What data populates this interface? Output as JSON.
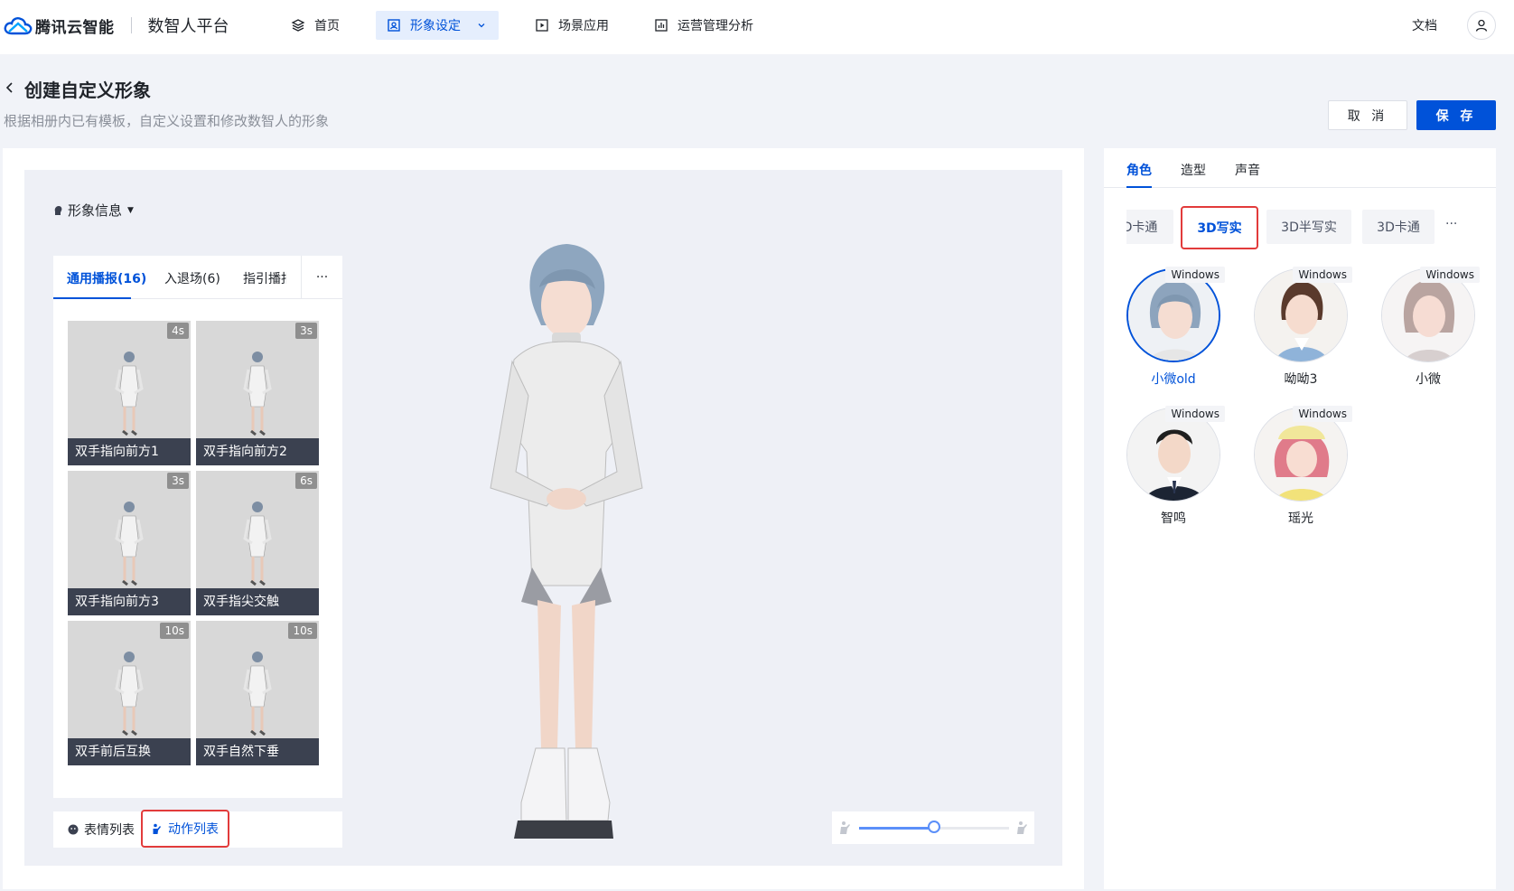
{
  "header": {
    "brand": "腾讯云智能",
    "product": "数智人平台",
    "nav": [
      {
        "label": "首页",
        "icon": "layers-icon"
      },
      {
        "label": "形象设定",
        "icon": "portrait-icon",
        "active": true
      },
      {
        "label": "场景应用",
        "icon": "play-icon"
      },
      {
        "label": "运营管理分析",
        "icon": "chart-icon"
      }
    ],
    "doc_label": "文档"
  },
  "page": {
    "title": "创建自定义形象",
    "subtitle": "根据相册内已有模板，自定义设置和修改数智人的形象",
    "cancel_label": "取 消",
    "save_label": "保 存"
  },
  "stage": {
    "info_label": "形象信息",
    "motion_tabs": [
      "通用播报(16)",
      "入退场(6)",
      "指引播报"
    ],
    "more_label": "···",
    "motions": [
      {
        "name": "双手指向前方1",
        "duration": "4s"
      },
      {
        "name": "双手指向前方2",
        "duration": "3s"
      },
      {
        "name": "双手指向前方3",
        "duration": "3s"
      },
      {
        "name": "双手指尖交触",
        "duration": "6s"
      },
      {
        "name": "双手前后互换",
        "duration": "10s"
      },
      {
        "name": "双手自然下垂",
        "duration": "10s"
      }
    ],
    "tools": {
      "expression_label": "表情列表",
      "action_label": "动作列表"
    },
    "zoom_level": 0.5
  },
  "side": {
    "tabs": [
      "角色",
      "造型",
      "声音"
    ],
    "categories": [
      "D卡通",
      "3D写实",
      "3D半写实",
      "3D卡通"
    ],
    "more_label": "···",
    "roles": [
      {
        "name": "小微old",
        "tag": "Windows",
        "selected": true
      },
      {
        "name": "呦呦3",
        "tag": "Windows"
      },
      {
        "name": "小微",
        "tag": "Windows"
      },
      {
        "name": "智鸣",
        "tag": "Windows"
      },
      {
        "name": "瑶光",
        "tag": "Windows"
      }
    ]
  },
  "colors": {
    "accent": "#0052d9",
    "highlight": "#e23b3b"
  }
}
